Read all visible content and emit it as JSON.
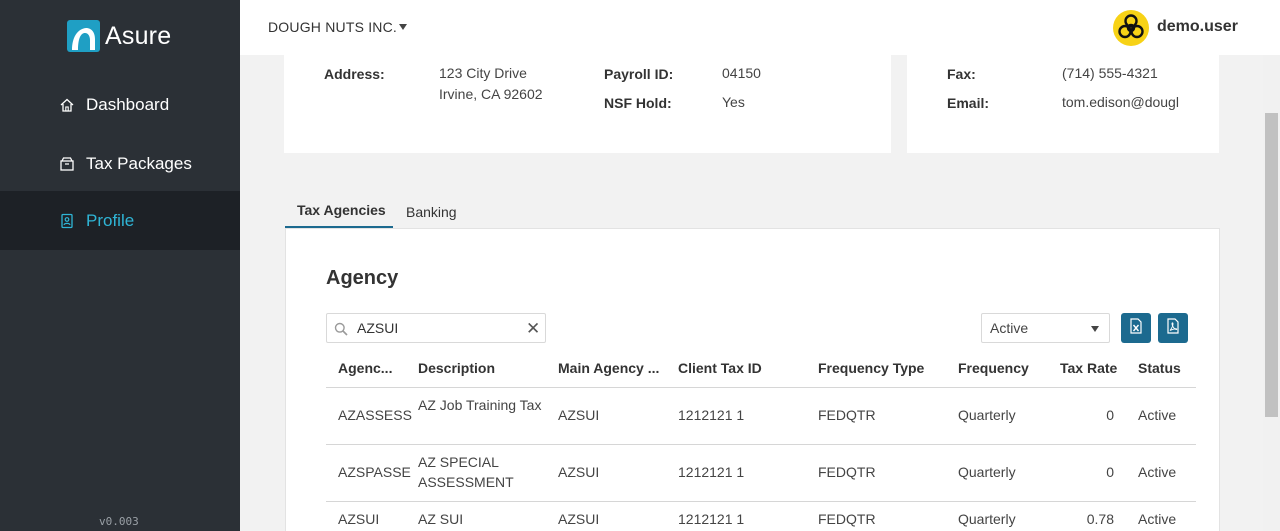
{
  "brand": {
    "name": "Asure"
  },
  "sidebar": {
    "items": [
      {
        "label": "Dashboard",
        "icon": "home-icon"
      },
      {
        "label": "Tax Packages",
        "icon": "package-icon"
      },
      {
        "label": "Profile",
        "icon": "profile-icon",
        "active": true
      }
    ],
    "version": "v0.003"
  },
  "topbar": {
    "company": "DOUGH NUTS INC.",
    "username": "demo.user",
    "avatar_icon": "biohazard-icon"
  },
  "info_left": {
    "address_label": "Address:",
    "address_line1": "123 City Drive",
    "address_line2": "Irvine, CA 92602",
    "payroll_label": "Payroll ID:",
    "payroll_value": "04150",
    "nsf_label": "NSF Hold:",
    "nsf_value": "Yes"
  },
  "info_right": {
    "fax_label": "Fax:",
    "fax_value": "(714) 555-4321",
    "email_label": "Email:",
    "email_value": "tom.edison@dougl"
  },
  "tabs": [
    {
      "label": "Tax Agencies",
      "active": true
    },
    {
      "label": "Banking"
    }
  ],
  "agency": {
    "title": "Agency",
    "search_value": "AZSUI",
    "status_filter": "Active",
    "export_icons": [
      "excel-export-icon",
      "pdf-export-icon"
    ],
    "columns": [
      "Agenc...",
      "Description",
      "Main Agency ...",
      "Client Tax ID",
      "Frequency Type",
      "Frequency",
      "Tax Rate",
      "Status"
    ],
    "rows": [
      {
        "agency": "AZASSESS",
        "description": "AZ Job Training Tax",
        "main_agency": "AZSUI",
        "client_tax_id": "1212121 1",
        "frequency_type": "FEDQTR",
        "frequency": "Quarterly",
        "tax_rate": "0",
        "status": "Active"
      },
      {
        "agency": "AZSPASSE",
        "description": "AZ SPECIAL ASSESSMENT",
        "main_agency": "AZSUI",
        "client_tax_id": "1212121 1",
        "frequency_type": "FEDQTR",
        "frequency": "Quarterly",
        "tax_rate": "0",
        "status": "Active"
      },
      {
        "agency": "AZSUI",
        "description": "AZ SUI",
        "main_agency": "AZSUI",
        "client_tax_id": "1212121 1",
        "frequency_type": "FEDQTR",
        "frequency": "Quarterly",
        "tax_rate": "0.78",
        "status": "Active"
      }
    ]
  },
  "colors": {
    "sidebar_bg": "#2b3036",
    "accent": "#2fb5d6",
    "primary": "#1c6a8f",
    "avatar_bg": "#f7d216"
  }
}
